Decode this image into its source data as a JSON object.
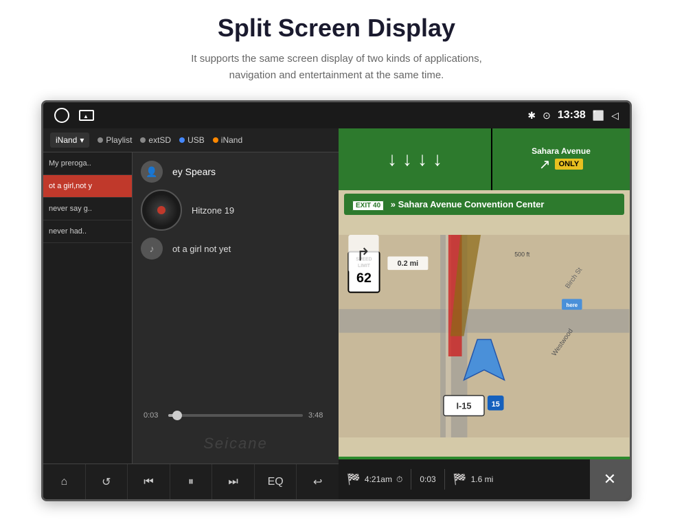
{
  "page": {
    "title": "Split Screen Display",
    "subtitle_line1": "It supports the same screen display of two kinds of applications,",
    "subtitle_line2": "navigation and entertainment at the same time."
  },
  "status_bar": {
    "time": "13:38",
    "bluetooth": "✱",
    "location": "⊙",
    "window": "⬜",
    "back": "◁"
  },
  "music": {
    "source_label": "iNand",
    "sources": [
      "Playlist",
      "extSD",
      "USB",
      "iNand"
    ],
    "playlist": [
      {
        "label": "My preroga..",
        "active": false
      },
      {
        "label": "ot a girl,not y",
        "active": true
      },
      {
        "label": "never say g..",
        "active": false
      },
      {
        "label": "never had..",
        "active": false
      }
    ],
    "artist": "ey Spears",
    "album": "Hitzone 19",
    "track": "ot a girl not yet",
    "time_current": "0:03",
    "time_total": "3:48",
    "progress_percent": 3,
    "watermark": "Seicane",
    "controls": [
      "⌂",
      "↺",
      "⏮",
      "⏸",
      "⏭",
      "EQ",
      "↩"
    ]
  },
  "navigation": {
    "exit_label": "EXIT 40",
    "destination": "» Sahara Avenue Convention Center",
    "street_top": "Sahara Avenue",
    "only_label": "ONLY",
    "speed_prefix": "LIMIT",
    "speed_value": "62",
    "distance_small": "0.2 mi",
    "highway_label": "I-15",
    "highway_number": "15",
    "birch_label": "Birch St",
    "west_label": "Westwood",
    "bottom": {
      "flag_start": "🏁",
      "time_start": "4:21am",
      "timer_icon": "⏱",
      "elapsed": "0:03",
      "flag_end": "🏁",
      "distance": "1.6 mi",
      "close_icon": "✕"
    }
  }
}
